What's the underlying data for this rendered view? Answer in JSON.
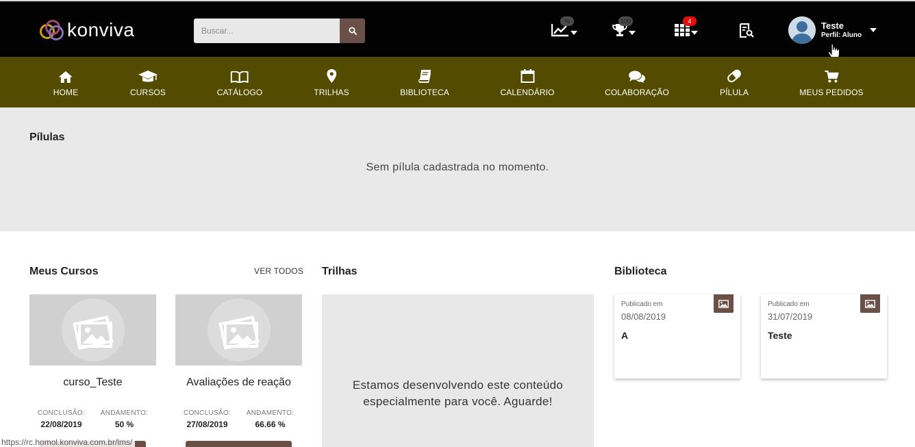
{
  "header": {
    "logo_text": "konviva",
    "search_placeholder": "Buscar...",
    "badges": {
      "progress": "%",
      "trophy": "100",
      "apps": "4"
    },
    "user": {
      "name": "Teste",
      "role": "Perfil: Aluno"
    }
  },
  "nav": [
    {
      "label": "HOME",
      "icon": "home-icon"
    },
    {
      "label": "CURSOS",
      "icon": "graduation-cap-icon"
    },
    {
      "label": "CATÁLOGO",
      "icon": "open-book-icon"
    },
    {
      "label": "TRILHAS",
      "icon": "map-marker-icon"
    },
    {
      "label": "BIBLIOTECA",
      "icon": "book-icon"
    },
    {
      "label": "CALENDÁRIO",
      "icon": "calendar-icon"
    },
    {
      "label": "COLABORAÇÃO",
      "icon": "chat-bubbles-icon"
    },
    {
      "label": "PÍLULA",
      "icon": "pill-icon"
    },
    {
      "label": "MEUS PEDIDOS",
      "icon": "cart-icon"
    }
  ],
  "pilulas": {
    "title": "Pílulas",
    "empty": "Sem pílula cadastrada no momento."
  },
  "courses": {
    "title": "Meus Cursos",
    "ver_todos": "VER TODOS",
    "items": [
      {
        "name": "curso_Teste",
        "conclusao_label": "CONCLUSÃO:",
        "conclusao": "22/08/2019",
        "andamento_label": "ANDAMENTO:",
        "andamento": "50 %"
      },
      {
        "name": "Avaliações de reação",
        "conclusao_label": "CONCLUSÃO:",
        "conclusao": "27/08/2019",
        "andamento_label": "ANDAMENTO:",
        "andamento": "66.66 %"
      }
    ]
  },
  "trilhas": {
    "title": "Trilhas",
    "message": "Estamos desenvolvendo este conteúdo especialmente para você. Aguarde!"
  },
  "biblioteca": {
    "title": "Biblioteca",
    "items": [
      {
        "published_label": "Publicado em",
        "date": "08/08/2019",
        "title": "A"
      },
      {
        "published_label": "Publicado em",
        "date": "31/07/2019",
        "title": "Teste"
      }
    ]
  },
  "status_bar": {
    "url": "https://rc.homol.konviva.com.br/lms/"
  },
  "colors": {
    "topbar": "#020202",
    "nav": "#534c00",
    "accent": "#6a5047",
    "badge_red": "#e40f0f",
    "panel": "#e9e9e9"
  }
}
